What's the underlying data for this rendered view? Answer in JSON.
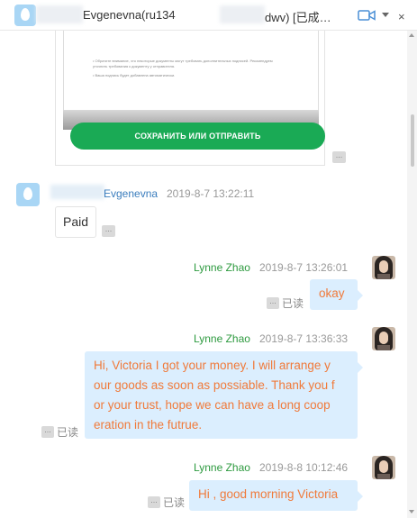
{
  "window": {
    "title_name": "Evgenevna(ru134",
    "title_tail": "dwv) [已成…",
    "close_glyph": "×"
  },
  "document_preview": {
    "lines": [
      "• Обратите внимание, что некоторые документы могут требовать дополнительных подписей. Рекомендуем",
      "  уточнить требования к документу у отправителя.",
      "• Ваша подпись будет добавлена автоматически."
    ],
    "button_label": "СОХРАНИТЬ ИЛИ ОТПРАВИТЬ"
  },
  "messages": [
    {
      "sender": "Evgenevna",
      "time": "2019-8-7 13:22:11",
      "text": "Paid",
      "side": "left"
    },
    {
      "sender": "Lynne Zhao",
      "time": "2019-8-7 13:26:01",
      "text": "okay",
      "read": "已读",
      "side": "right"
    },
    {
      "sender": "Lynne Zhao",
      "time": "2019-8-7 13:36:33",
      "text_lines": [
        "Hi, Victoria I got your money. I will arrange y",
        "our goods as soon as possiable.  Thank you f",
        "or your trust, hope we can have a long coop",
        "eration in the futrue."
      ],
      "read": "已读",
      "side": "right"
    },
    {
      "sender": "Lynne Zhao",
      "time": "2019-8-8 10:12:46",
      "text": "Hi , good morning Victoria",
      "read": "已读",
      "side": "right"
    }
  ],
  "more_glyph": "...",
  "colors": {
    "bubble_right": "#dbeefe",
    "text_right": "#f07a3a",
    "sender_right": "#2d9a3f",
    "sender_left": "#3a7dbd",
    "doc_button": "#1aaa55"
  }
}
